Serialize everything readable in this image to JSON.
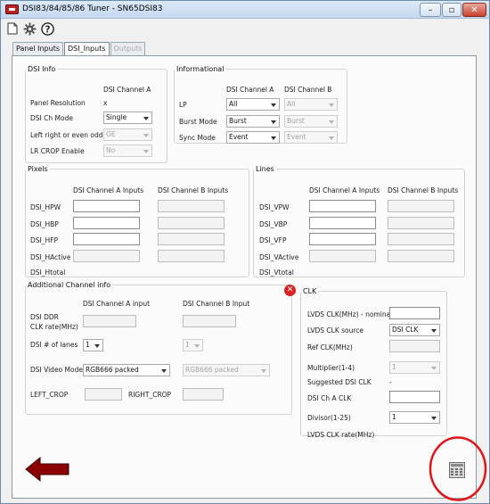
{
  "window": {
    "title": "DSI83/84/85/86 Tuner - SN65DSI83",
    "minimize": "–",
    "maximize": "▫",
    "close": "✕"
  },
  "toolbar": {
    "icons": [
      "document-icon",
      "gear-icon",
      "help-icon"
    ]
  },
  "tabs": [
    {
      "label": "Panel Inputs",
      "state": "normal"
    },
    {
      "label": "DSI_Inputs",
      "state": "active"
    },
    {
      "label": "Outputs",
      "state": "disabled"
    }
  ],
  "dsi_info": {
    "legend": "DSI Info",
    "col_a": "DSI Channel A",
    "panel_resolution_label": "Panel Resolution",
    "panel_resolution_value": "x",
    "ch_mode_label": "DSI Ch Mode",
    "ch_mode_value": "Single",
    "lr_even_odd_label": "Left right or even odd",
    "lr_even_odd_value": "OE",
    "lr_crop_label": "LR CROP Enable",
    "lr_crop_value": "No"
  },
  "informational": {
    "legend": "Informational",
    "col_a": "DSI Channel A",
    "col_b": "DSI Channel B",
    "lp_label": "LP",
    "lp_a": "All",
    "lp_b": "All",
    "burst_label": "Burst Mode",
    "burst_a": "Burst",
    "burst_b": "Burst",
    "sync_label": "Sync Mode",
    "sync_a": "Event",
    "sync_b": "Event"
  },
  "pixels": {
    "legend": "Pixels",
    "col_a": "DSI Channel A Inputs",
    "col_b": "DSI Channel B Inputs",
    "rows": [
      "DSI_HPW",
      "DSI_HBP",
      "DSI_HFP",
      "DSI_HActive",
      "DSI_Htotal"
    ]
  },
  "lines": {
    "legend": "Lines",
    "col_a": "DSI Channel A Inputs",
    "col_b": "DSI Channel B Inputs",
    "rows": [
      "DSI_VPW",
      "DSI_VBP",
      "DSI_VFP",
      "DSI_VActive",
      "DSI_Vtotal"
    ]
  },
  "additional": {
    "legend": "Additional Channel info",
    "col_a": "DSI Channel A input",
    "col_b": "DSI Channel B Input",
    "ddr_label_1": "DSI DDR",
    "ddr_label_2": "CLK rate(MHz)",
    "lanes_label": "DSI # of lanes",
    "lanes_a": "1",
    "lanes_b": "1",
    "video_mode_label": "DSI Video Mode",
    "video_mode_a": "RGB666 packed",
    "video_mode_b": "RGB666 packed",
    "left_crop_label": "LEFT_CROP",
    "right_crop_label": "RIGHT_CROP"
  },
  "clk": {
    "legend": "CLK",
    "error_badge": "✕",
    "lvds_clk_nominal_label": "LVDS CLK(MHz) - nominal",
    "lvds_clk_source_label": "LVDS CLK source",
    "lvds_clk_source_value": "DSI CLK",
    "ref_clk_label": "Ref CLK(MHz)",
    "multiplier_label": "Multiplier(1-4)",
    "multiplier_value": "1",
    "suggested_label": "Suggested DSI CLK",
    "suggested_value": "-",
    "dsi_ch_a_clk_label": "DSI Ch A CLK",
    "divisor_label": "Divisor(1-25)",
    "divisor_value": "1",
    "lvds_clk_rate_label": "LVDS CLK rate(MHz)"
  },
  "colors": {
    "arrow": "#8b0000",
    "highlight_circle": "#e0151a"
  }
}
